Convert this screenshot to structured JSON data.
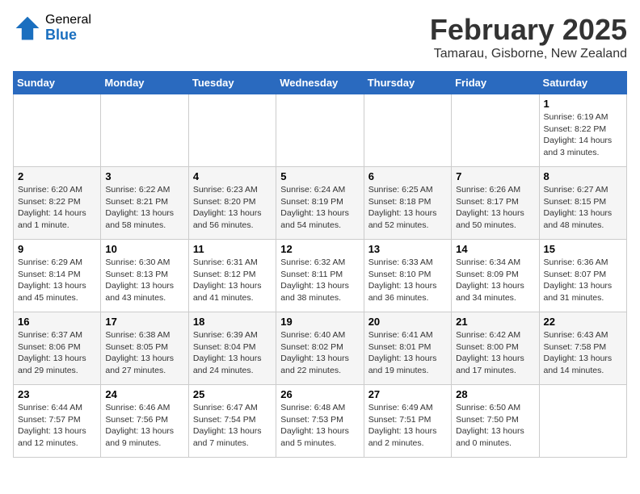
{
  "logo": {
    "general": "General",
    "blue": "Blue"
  },
  "title": "February 2025",
  "location": "Tamarau, Gisborne, New Zealand",
  "days_of_week": [
    "Sunday",
    "Monday",
    "Tuesday",
    "Wednesday",
    "Thursday",
    "Friday",
    "Saturday"
  ],
  "weeks": [
    [
      {
        "day": "",
        "info": ""
      },
      {
        "day": "",
        "info": ""
      },
      {
        "day": "",
        "info": ""
      },
      {
        "day": "",
        "info": ""
      },
      {
        "day": "",
        "info": ""
      },
      {
        "day": "",
        "info": ""
      },
      {
        "day": "1",
        "info": "Sunrise: 6:19 AM\nSunset: 8:22 PM\nDaylight: 14 hours\nand 3 minutes."
      }
    ],
    [
      {
        "day": "2",
        "info": "Sunrise: 6:20 AM\nSunset: 8:22 PM\nDaylight: 14 hours\nand 1 minute."
      },
      {
        "day": "3",
        "info": "Sunrise: 6:22 AM\nSunset: 8:21 PM\nDaylight: 13 hours\nand 58 minutes."
      },
      {
        "day": "4",
        "info": "Sunrise: 6:23 AM\nSunset: 8:20 PM\nDaylight: 13 hours\nand 56 minutes."
      },
      {
        "day": "5",
        "info": "Sunrise: 6:24 AM\nSunset: 8:19 PM\nDaylight: 13 hours\nand 54 minutes."
      },
      {
        "day": "6",
        "info": "Sunrise: 6:25 AM\nSunset: 8:18 PM\nDaylight: 13 hours\nand 52 minutes."
      },
      {
        "day": "7",
        "info": "Sunrise: 6:26 AM\nSunset: 8:17 PM\nDaylight: 13 hours\nand 50 minutes."
      },
      {
        "day": "8",
        "info": "Sunrise: 6:27 AM\nSunset: 8:15 PM\nDaylight: 13 hours\nand 48 minutes."
      }
    ],
    [
      {
        "day": "9",
        "info": "Sunrise: 6:29 AM\nSunset: 8:14 PM\nDaylight: 13 hours\nand 45 minutes."
      },
      {
        "day": "10",
        "info": "Sunrise: 6:30 AM\nSunset: 8:13 PM\nDaylight: 13 hours\nand 43 minutes."
      },
      {
        "day": "11",
        "info": "Sunrise: 6:31 AM\nSunset: 8:12 PM\nDaylight: 13 hours\nand 41 minutes."
      },
      {
        "day": "12",
        "info": "Sunrise: 6:32 AM\nSunset: 8:11 PM\nDaylight: 13 hours\nand 38 minutes."
      },
      {
        "day": "13",
        "info": "Sunrise: 6:33 AM\nSunset: 8:10 PM\nDaylight: 13 hours\nand 36 minutes."
      },
      {
        "day": "14",
        "info": "Sunrise: 6:34 AM\nSunset: 8:09 PM\nDaylight: 13 hours\nand 34 minutes."
      },
      {
        "day": "15",
        "info": "Sunrise: 6:36 AM\nSunset: 8:07 PM\nDaylight: 13 hours\nand 31 minutes."
      }
    ],
    [
      {
        "day": "16",
        "info": "Sunrise: 6:37 AM\nSunset: 8:06 PM\nDaylight: 13 hours\nand 29 minutes."
      },
      {
        "day": "17",
        "info": "Sunrise: 6:38 AM\nSunset: 8:05 PM\nDaylight: 13 hours\nand 27 minutes."
      },
      {
        "day": "18",
        "info": "Sunrise: 6:39 AM\nSunset: 8:04 PM\nDaylight: 13 hours\nand 24 minutes."
      },
      {
        "day": "19",
        "info": "Sunrise: 6:40 AM\nSunset: 8:02 PM\nDaylight: 13 hours\nand 22 minutes."
      },
      {
        "day": "20",
        "info": "Sunrise: 6:41 AM\nSunset: 8:01 PM\nDaylight: 13 hours\nand 19 minutes."
      },
      {
        "day": "21",
        "info": "Sunrise: 6:42 AM\nSunset: 8:00 PM\nDaylight: 13 hours\nand 17 minutes."
      },
      {
        "day": "22",
        "info": "Sunrise: 6:43 AM\nSunset: 7:58 PM\nDaylight: 13 hours\nand 14 minutes."
      }
    ],
    [
      {
        "day": "23",
        "info": "Sunrise: 6:44 AM\nSunset: 7:57 PM\nDaylight: 13 hours\nand 12 minutes."
      },
      {
        "day": "24",
        "info": "Sunrise: 6:46 AM\nSunset: 7:56 PM\nDaylight: 13 hours\nand 9 minutes."
      },
      {
        "day": "25",
        "info": "Sunrise: 6:47 AM\nSunset: 7:54 PM\nDaylight: 13 hours\nand 7 minutes."
      },
      {
        "day": "26",
        "info": "Sunrise: 6:48 AM\nSunset: 7:53 PM\nDaylight: 13 hours\nand 5 minutes."
      },
      {
        "day": "27",
        "info": "Sunrise: 6:49 AM\nSunset: 7:51 PM\nDaylight: 13 hours\nand 2 minutes."
      },
      {
        "day": "28",
        "info": "Sunrise: 6:50 AM\nSunset: 7:50 PM\nDaylight: 13 hours\nand 0 minutes."
      },
      {
        "day": "",
        "info": ""
      }
    ]
  ]
}
